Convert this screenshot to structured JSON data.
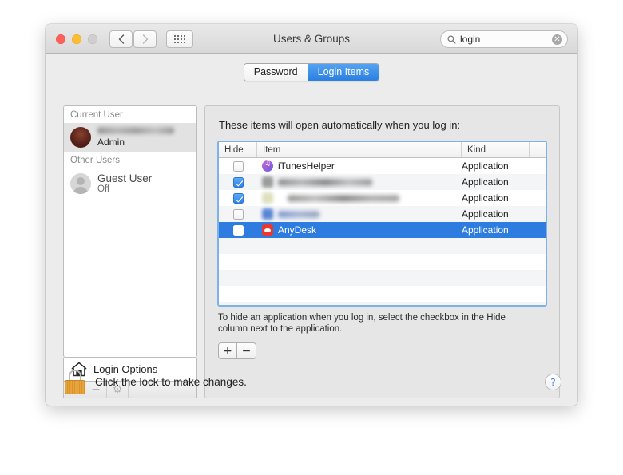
{
  "window": {
    "title": "Users & Groups",
    "traffic": {
      "close": "close-button",
      "minimize": "minimize-button",
      "zoom": "zoom-button"
    },
    "nav": {
      "back": "back-button",
      "forward": "forward-button",
      "grid": "show-all-button"
    }
  },
  "search": {
    "value": "login",
    "placeholder": "Search",
    "clear": "✕"
  },
  "tabs": [
    {
      "label": "Password",
      "active": false
    },
    {
      "label": "Login Items",
      "active": true
    }
  ],
  "sidebar": {
    "groups": [
      {
        "header": "Current User",
        "users": [
          {
            "name": "",
            "name_blurred": true,
            "sub": "Admin",
            "selected": true,
            "avatar": "admin-photo"
          }
        ]
      },
      {
        "header": "Other Users",
        "users": [
          {
            "name": "Guest User",
            "name_blurred": false,
            "sub": "Off",
            "selected": false,
            "avatar": "guest-silhouette"
          }
        ]
      }
    ],
    "login_options": "Login Options",
    "toolbar": {
      "add": "+",
      "remove": "−",
      "settings": "⚙"
    }
  },
  "panel": {
    "title": "These items will open automatically when you log in:",
    "columns": [
      "Hide",
      "Item",
      "Kind"
    ],
    "rows": [
      {
        "hide": false,
        "item": "iTunesHelper",
        "item_blurred": false,
        "kind": "Application",
        "icon": "itunes-icon",
        "selected": false
      },
      {
        "hide": true,
        "item": "",
        "item_blurred": true,
        "kind": "Application",
        "icon": "app-icon-blurred",
        "selected": false
      },
      {
        "hide": true,
        "item": "",
        "item_blurred": true,
        "kind": "Application",
        "icon": "app-icon-blurred",
        "selected": false
      },
      {
        "hide": false,
        "item": "",
        "item_blurred": true,
        "kind": "Application",
        "icon": "app-icon-blurred",
        "selected": false
      },
      {
        "hide": false,
        "item": "AnyDesk",
        "item_blurred": false,
        "kind": "Application",
        "icon": "anydesk-icon",
        "selected": true
      }
    ],
    "hint": "To hide an application when you log in, select the checkbox in the Hide column next to the application.",
    "add_label": "+",
    "remove_label": "−"
  },
  "lockbar": {
    "text": "Click the lock to make changes.",
    "lock_state": "locked",
    "help_label": "?"
  },
  "colors": {
    "accent_blue": "#2e7ce0",
    "tab_active": "#2a7fe0",
    "focus_ring": "#7bb2ec",
    "lock_gold": "#e8a33d",
    "anydesk_red": "#e8382f",
    "window_bg": "#ececec",
    "panel_bg": "#e6e6e6"
  }
}
